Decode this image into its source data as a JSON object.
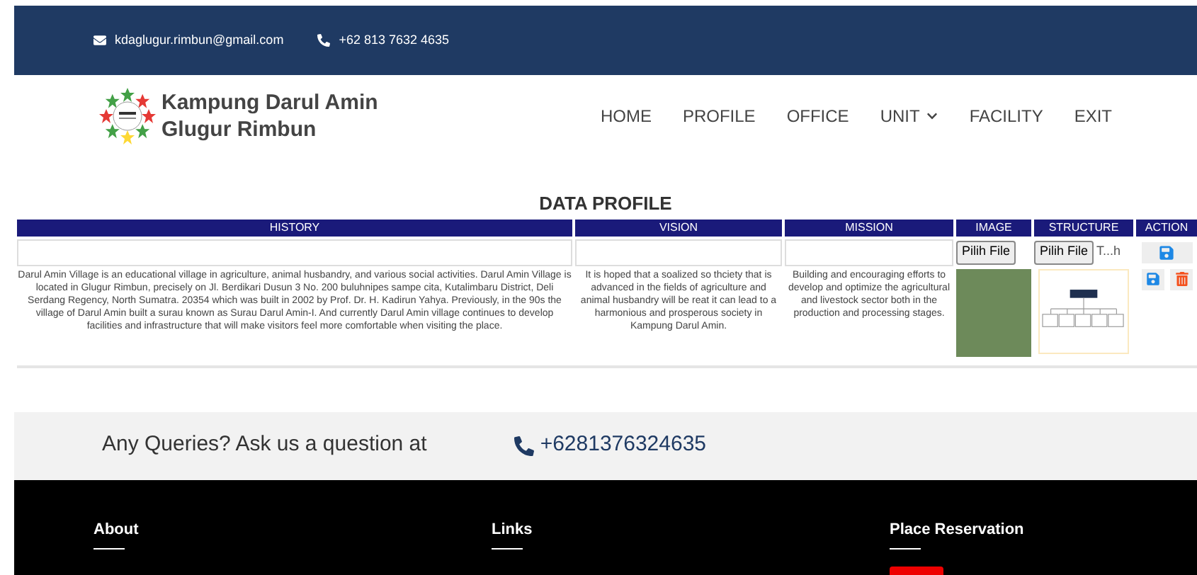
{
  "topbar": {
    "email": "kdaglugur.rimbun@gmail.com",
    "phone": "+62 813 7632 4635"
  },
  "brand": {
    "line1": "Kampung Darul Amin",
    "line2": "Glugur Rimbun"
  },
  "nav": [
    {
      "label": "HOME",
      "dropdown": false
    },
    {
      "label": "PROFILE",
      "dropdown": false
    },
    {
      "label": "OFFICE",
      "dropdown": false
    },
    {
      "label": "UNIT",
      "dropdown": true
    },
    {
      "label": "FACILITY",
      "dropdown": false
    },
    {
      "label": "EXIT",
      "dropdown": false
    }
  ],
  "title": "DATA PROFILE",
  "table": {
    "columns": [
      "HISTORY",
      "VISION",
      "MISSION",
      "IMAGE",
      "STRUCTURE",
      "ACTION"
    ],
    "file_buttons": [
      "Pilih File",
      "Pilih File"
    ],
    "file_name": "T...h",
    "row": {
      "history": "Darul Amin Village is an educational village in agriculture, animal husbandry, and various social activities. Darul Amin Village is located in Glugur Rimbun, precisely on Jl. Berdikari Dusun 3 No. 200 buluhnipes sampe cita, Kutalimbaru District, Deli Serdang Regency, North Sumatra. 20354 which was built in 2002 by Prof. Dr. H. Kadirun Yahya. Previously, in the 90s the village of Darul Amin built a surau known as Surau Darul Amin-I. And currently Darul Amin village continues to develop facilities and infrastructure that will make visitors feel more comfortable when visiting the place.",
      "vision": "It is hoped that a soalized so thciety that is advanced in the fields of agriculture and animal husbandry will be reat it can lead to a harmonious and prosperous society in Kampung Darul Amin.",
      "mission": "Building and encouraging efforts to develop and optimize the agricultural and livestock sector both in the production and processing stages."
    }
  },
  "query": {
    "text": "Any Queries? Ask us a question at",
    "phone": "+6281376324635"
  },
  "footer": {
    "headings": [
      "About",
      "Links",
      "Place Reservation"
    ]
  }
}
